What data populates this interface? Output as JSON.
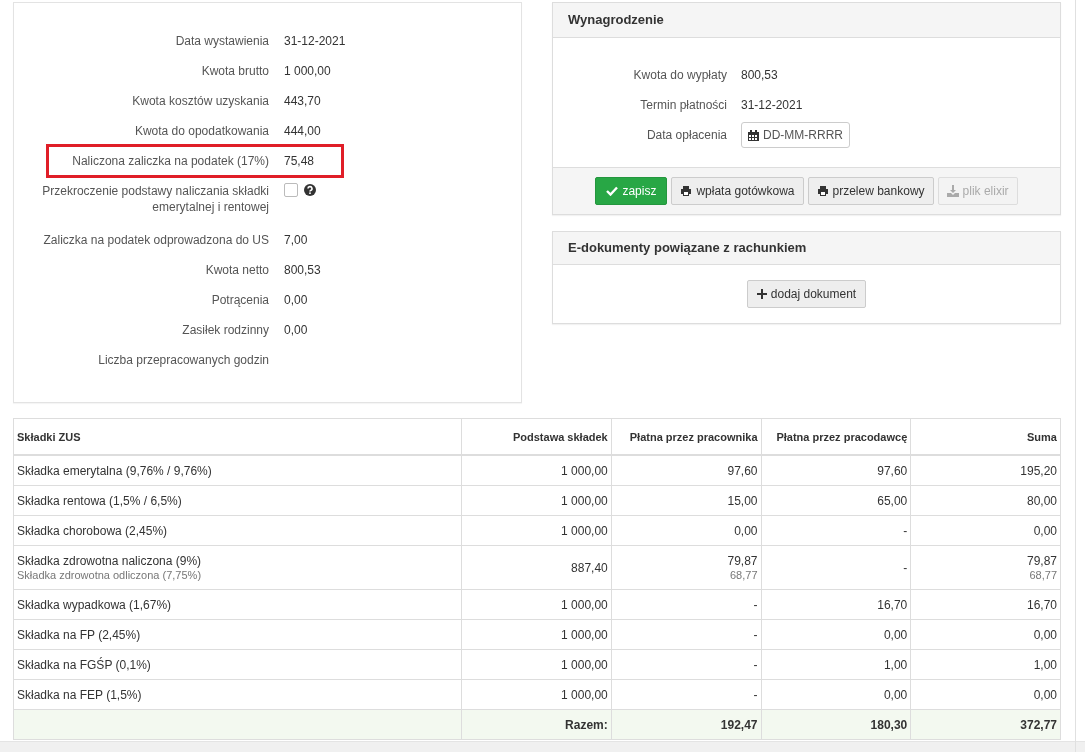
{
  "summary": {
    "rows": [
      {
        "kind": "text",
        "label": "Data wystawienia",
        "value": "31-12-2021",
        "highlighted": false
      },
      {
        "kind": "text",
        "label": "Kwota brutto",
        "value": "1 000,00",
        "highlighted": false
      },
      {
        "kind": "text",
        "label": "Kwota kosztów uzyskania",
        "value": "443,70",
        "highlighted": false
      },
      {
        "kind": "text",
        "label": "Kwota do opodatkowania",
        "value": "444,00",
        "highlighted": false
      },
      {
        "kind": "text",
        "label": "Naliczona zaliczka na podatek (17%)",
        "value": "75,48",
        "highlighted": true
      },
      {
        "kind": "checkbox",
        "label": "Przekroczenie podstawy naliczania składki emerytalnej i rentowej",
        "checked": false,
        "highlighted": false
      },
      {
        "kind": "text",
        "label": "Zaliczka na podatek odprowadzona do US",
        "value": "7,00",
        "highlighted": false
      },
      {
        "kind": "text",
        "label": "Kwota netto",
        "value": "800,53",
        "highlighted": false
      },
      {
        "kind": "text",
        "label": "Potrącenia",
        "value": "0,00",
        "highlighted": false
      },
      {
        "kind": "text",
        "label": "Zasiłek rodzinny",
        "value": "0,00",
        "highlighted": false
      },
      {
        "kind": "text",
        "label": "Liczba przepracowanych godzin",
        "highlighted": false
      }
    ]
  },
  "payment": {
    "title": "Wynagrodzenie",
    "fields": [
      {
        "kind": "text",
        "label": "Kwota do wypłaty",
        "value": "800,53"
      },
      {
        "kind": "text",
        "label": "Termin płatności",
        "value": "31-12-2021"
      },
      {
        "kind": "date",
        "label": "Data opłacenia",
        "placeholder": "DD-MM-RRRR"
      }
    ],
    "buttons": [
      {
        "kind": "save",
        "label": "zapisz",
        "disabled": false
      },
      {
        "kind": "print",
        "label": "wpłata gotówkowa",
        "disabled": false
      },
      {
        "kind": "print",
        "label": "przelew bankowy",
        "disabled": false
      },
      {
        "kind": "export",
        "label": "plik elixir",
        "disabled": true
      }
    ]
  },
  "documents": {
    "title": "E-dokumenty powiązane z rachunkiem",
    "button": "dodaj dokument"
  },
  "table": {
    "columns": [
      "Składki ZUS",
      "Podstawa składek",
      "Płatna przez pracownika",
      "Płatna przez pracodawcę",
      "Suma"
    ],
    "rows": [
      {
        "cells": [
          {
            "value": "Składka emerytalna (9,76% / 9,76%)"
          },
          {
            "value": "1 000,00"
          },
          {
            "value": "97,60"
          },
          {
            "value": "97,60"
          },
          {
            "value": "195,20"
          }
        ]
      },
      {
        "cells": [
          {
            "value": "Składka rentowa (1,5% / 6,5%)"
          },
          {
            "value": "1 000,00"
          },
          {
            "value": "15,00"
          },
          {
            "value": "65,00"
          },
          {
            "value": "80,00"
          }
        ]
      },
      {
        "cells": [
          {
            "value": "Składka chorobowa (2,45%)"
          },
          {
            "value": "1 000,00"
          },
          {
            "value": "0,00"
          },
          {
            "value": "-"
          },
          {
            "value": "0,00"
          }
        ]
      },
      {
        "cells": [
          {
            "value": "Składka zdrowotna naliczona (9%)",
            "sub_value": "Składka zdrowotna odliczona (7,75%)"
          },
          {
            "value": "887,40"
          },
          {
            "value": "79,87",
            "sub_value": "68,77"
          },
          {
            "value": "-"
          },
          {
            "value": "79,87",
            "sub_value": "68,77"
          }
        ]
      },
      {
        "cells": [
          {
            "value": "Składka wypadkowa (1,67%)"
          },
          {
            "value": "1 000,00"
          },
          {
            "value": "-"
          },
          {
            "value": "16,70"
          },
          {
            "value": "16,70"
          }
        ]
      },
      {
        "cells": [
          {
            "value": "Składka na FP (2,45%)"
          },
          {
            "value": "1 000,00"
          },
          {
            "value": "-"
          },
          {
            "value": "0,00"
          },
          {
            "value": "0,00"
          }
        ]
      },
      {
        "cells": [
          {
            "value": "Składka na FGŚP (0,1%)"
          },
          {
            "value": "1 000,00"
          },
          {
            "value": "-"
          },
          {
            "value": "1,00"
          },
          {
            "value": "1,00"
          }
        ]
      },
      {
        "cells": [
          {
            "value": "Składka na FEP (1,5%)"
          },
          {
            "value": "1 000,00"
          },
          {
            "value": "-"
          },
          {
            "value": "0,00"
          },
          {
            "value": "0,00"
          }
        ]
      }
    ],
    "footer": {
      "label": "Razem:",
      "values": [
        "192,47",
        "180,30",
        "372,77"
      ]
    }
  }
}
